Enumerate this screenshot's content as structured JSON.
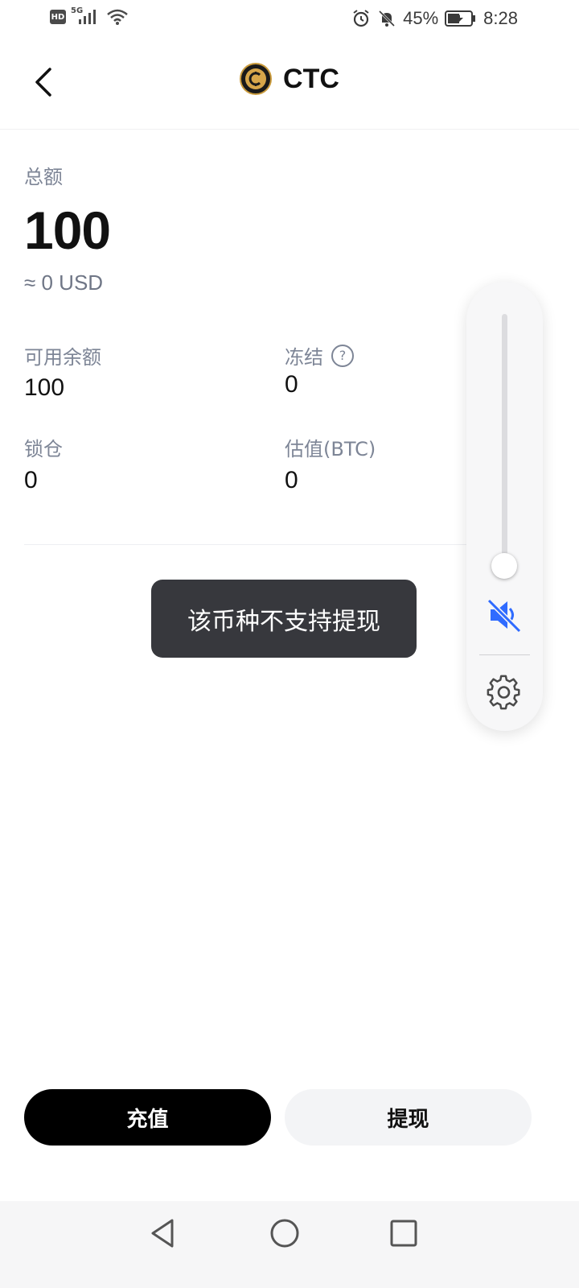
{
  "status_bar": {
    "network_badge": "HD",
    "network_type": "5G",
    "battery_percent": "45%",
    "time": "8:28",
    "icons": [
      "signal-icon",
      "wifi-icon",
      "alarm-icon",
      "bell-off-icon",
      "battery-icon"
    ]
  },
  "header": {
    "title": "CTC",
    "coin_icon": "coin-icon",
    "back_icon": "chevron-left-icon"
  },
  "balance": {
    "total_label": "总额",
    "total_value": "100",
    "total_usd": "≈ 0 USD",
    "available_label": "可用余额",
    "available_value": "100",
    "frozen_label": "冻结",
    "frozen_value": "0",
    "locked_label": "锁仓",
    "locked_value": "0",
    "estimate_label": "估值(BTC)",
    "estimate_value": "0"
  },
  "toast": {
    "message": "该币种不支持提现"
  },
  "volume_panel": {
    "level": 0.0,
    "muted": true,
    "accent_color": "#2f6bff"
  },
  "actions": {
    "deposit_label": "充值",
    "withdraw_label": "提现"
  },
  "nav_bar": {
    "items": [
      "back-triangle-icon",
      "home-circle-icon",
      "recents-square-icon"
    ]
  },
  "colors": {
    "primary_button": "#000000",
    "secondary_button": "#f3f4f6",
    "toast_bg": "#37383d",
    "label_gray": "#7d8596"
  }
}
